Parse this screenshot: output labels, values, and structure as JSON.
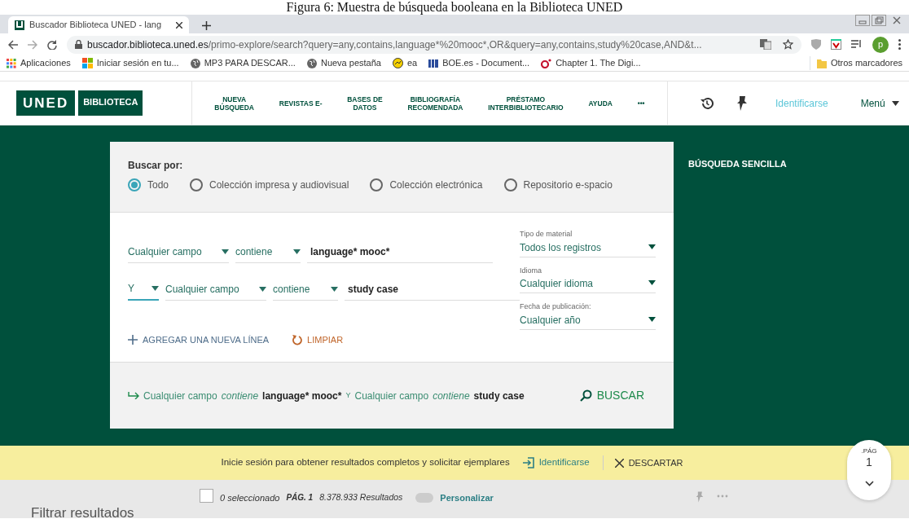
{
  "caption": "Figura 6: Muestra de búsqueda booleana en la Biblioteca UNED",
  "browser": {
    "tab": {
      "title": "Buscador Biblioteca UNED - lang"
    },
    "url": {
      "domain": "buscador.biblioteca.uned.es",
      "path": "/primo-explore/search?query=any,contains,language*%20mooc*,OR&query=any,contains,study%20case,AND&t..."
    },
    "bookmarks": [
      {
        "label": "Aplicaciones",
        "kind": "apps"
      },
      {
        "label": "Iniciar sesión en tu...",
        "kind": "windows"
      },
      {
        "label": "MP3 PARA DESCAR...",
        "kind": "globe"
      },
      {
        "label": "Nueva pestaña",
        "kind": "globe"
      },
      {
        "label": "ea",
        "kind": "smiley"
      },
      {
        "label": "BOE.es - Document...",
        "kind": "boe"
      },
      {
        "label": "Chapter 1. The Digi...",
        "kind": "oreilly"
      }
    ],
    "other_bookmarks": "Otros marcadores",
    "avatar": "p"
  },
  "site": {
    "logo": {
      "brand": "UNED",
      "name": "BIBLIOTECA"
    },
    "nav": [
      {
        "lines": [
          "NUEVA",
          "BÚSQUEDA"
        ]
      },
      {
        "lines": [
          "REVISTAS E-"
        ]
      },
      {
        "lines": [
          "BASES DE",
          "DATOS"
        ]
      },
      {
        "lines": [
          "BIBLIOGRAFÍA",
          "RECOMENDADA"
        ]
      },
      {
        "lines": [
          "PRÉSTAMO",
          "INTERBIBLIOTECARIO"
        ]
      },
      {
        "lines": [
          "AYUDA"
        ]
      },
      {
        "lines": [
          "•••"
        ]
      }
    ],
    "sign_in": "Identificarse",
    "menu": "Menú"
  },
  "search": {
    "label": "Buscar por:",
    "scopes": [
      {
        "label": "Todo",
        "selected": true
      },
      {
        "label": "Colección impresa y audiovisual",
        "selected": false
      },
      {
        "label": "Colección electrónica",
        "selected": false
      },
      {
        "label": "Repositorio e-spacio",
        "selected": false
      }
    ],
    "rows": [
      {
        "field": "Cualquier campo",
        "operator": "contiene",
        "value": "language* mooc*"
      },
      {
        "boolean": "Y",
        "field": "Cualquier campo",
        "operator": "contiene",
        "value": "study case"
      }
    ],
    "filters": [
      {
        "label": "Tipo de material",
        "value": "Todos los registros"
      },
      {
        "label": "Idioma",
        "value": "Cualquier idioma"
      },
      {
        "label": "Fecha de publicación:",
        "value": "Cualquier año"
      }
    ],
    "add_line": "AGREGAR UNA NUEVA LÍNEA",
    "clear": "LIMPIAR",
    "summary": [
      {
        "kind": "field",
        "text": "Cualquier campo"
      },
      {
        "kind": "operator",
        "text": "contiene"
      },
      {
        "kind": "value",
        "text": "language* mooc*"
      },
      {
        "kind": "boolean",
        "text": "Y"
      },
      {
        "kind": "field",
        "text": "Cualquier campo"
      },
      {
        "kind": "operator",
        "text": "contiene"
      },
      {
        "kind": "value",
        "text": "study case"
      }
    ],
    "search_button": "BUSCAR",
    "simple_search": "BÚSQUEDA SENCILLA"
  },
  "banner": {
    "message": "Inicie sesión para obtener resultados completos y solicitar ejemplares",
    "sign_in": "Identificarse",
    "dismiss": "DESCARTAR"
  },
  "page_badge": {
    "label": ".PÁG",
    "number": "1"
  },
  "results_bar": {
    "filter_title": "Filtrar resultados",
    "select_all_checked": false,
    "selected_count": "0 seleccionado",
    "page": "PÁG. 1",
    "count": "8.378.933 Resultados",
    "personalize": {
      "label": "Personalizar",
      "on": false
    }
  }
}
